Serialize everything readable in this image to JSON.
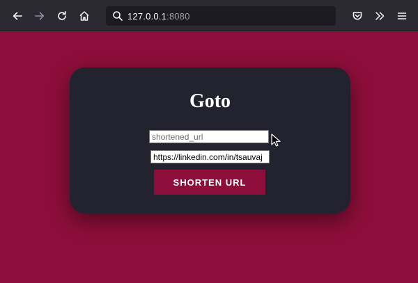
{
  "browser": {
    "url_host": "127.0.0.1",
    "url_port": ":8080"
  },
  "icons": {
    "back": "arrow-left-icon",
    "forward": "arrow-right-icon",
    "reload": "reload-icon",
    "home": "home-icon",
    "search": "search-icon",
    "pocket": "pocket-icon",
    "overflow": "chevrons-right-icon",
    "menu": "hamburger-menu-icon"
  },
  "colors": {
    "page_background": "#8d0e3a",
    "card_background": "#23232f",
    "button_background": "#8d0e3a"
  },
  "card": {
    "title": "Goto",
    "short_input": {
      "placeholder": "shortened_url"
    },
    "long_input": {
      "value": "https://linkedin.com/in/tsauvaj"
    },
    "submit_label": "Shorten URL"
  }
}
